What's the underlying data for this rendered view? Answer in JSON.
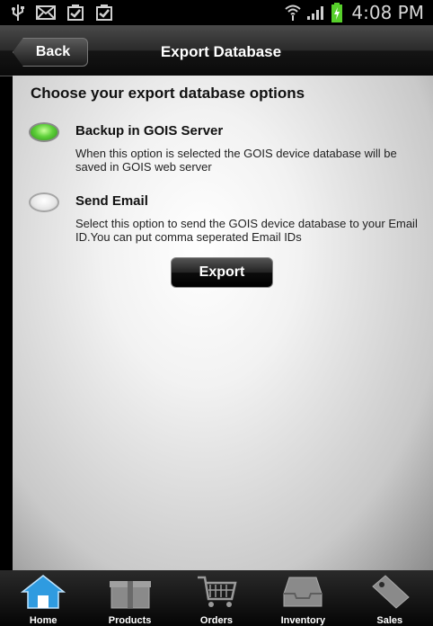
{
  "status_bar": {
    "time": "4:08 PM",
    "icons": [
      "usb-icon",
      "mail-icon",
      "clipboard-check-icon",
      "clipboard-check-icon",
      "wifi-icon",
      "signal-icon",
      "battery-charging-icon"
    ]
  },
  "header": {
    "back_label": "Back",
    "title": "Export Database"
  },
  "main": {
    "heading": "Choose your export database options",
    "options": [
      {
        "label": "Backup in GOIS Server",
        "description": "When this option is selected the GOIS device database will be saved in GOIS web server",
        "selected": true
      },
      {
        "label": "Send Email",
        "description": "Select this option to send the GOIS device database to your Email ID.You can put comma seperated Email IDs",
        "selected": false
      }
    ],
    "export_label": "Export"
  },
  "tabs": [
    {
      "label": "Home",
      "icon": "home-icon",
      "active": true
    },
    {
      "label": "Products",
      "icon": "gift-box-icon",
      "active": false
    },
    {
      "label": "Orders",
      "icon": "cart-icon",
      "active": false
    },
    {
      "label": "Inventory",
      "icon": "tray-icon",
      "active": false
    },
    {
      "label": "Sales",
      "icon": "price-tag-icon",
      "active": false
    }
  ],
  "colors": {
    "accent_active_tab": "#2f9be0",
    "radio_selected": "#5fd13a"
  }
}
